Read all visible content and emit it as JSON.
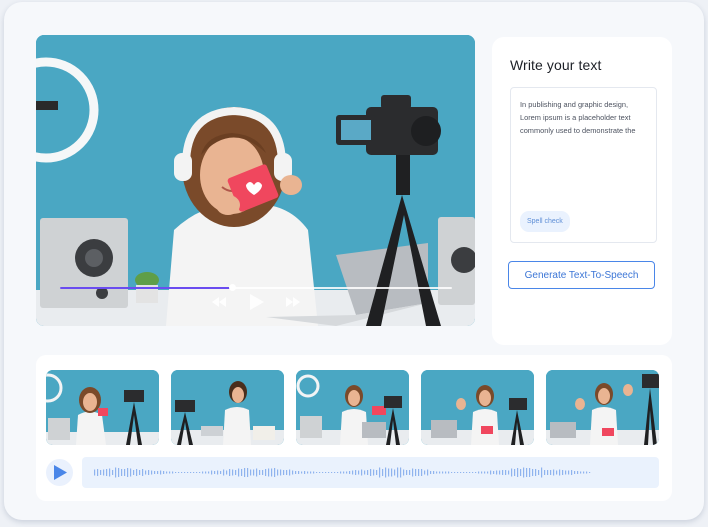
{
  "panel": {
    "title": "Write your text",
    "text_value": "In publishing and graphic design, Lorem ipsum is a placeholder text commonly used to demonstrate the",
    "spell_check_label": "Spell check",
    "generate_button_label": "Generate Text-To-Speech"
  },
  "player": {
    "progress": 0.44,
    "controls": [
      "rewind-icon",
      "play-icon",
      "fast-forward-icon"
    ]
  },
  "thumbnails": [
    {
      "name": "thumbnail-1"
    },
    {
      "name": "thumbnail-2"
    },
    {
      "name": "thumbnail-3"
    },
    {
      "name": "thumbnail-4"
    },
    {
      "name": "thumbnail-5"
    }
  ],
  "audio": {
    "play_icon": "play-icon",
    "waveform_icon": "waveform-icon"
  },
  "colors": {
    "accent": "#4a86e8",
    "progress": "#6a4cf0",
    "scene_background": "#4aa6c2",
    "waveform": "#8fb3ee"
  }
}
